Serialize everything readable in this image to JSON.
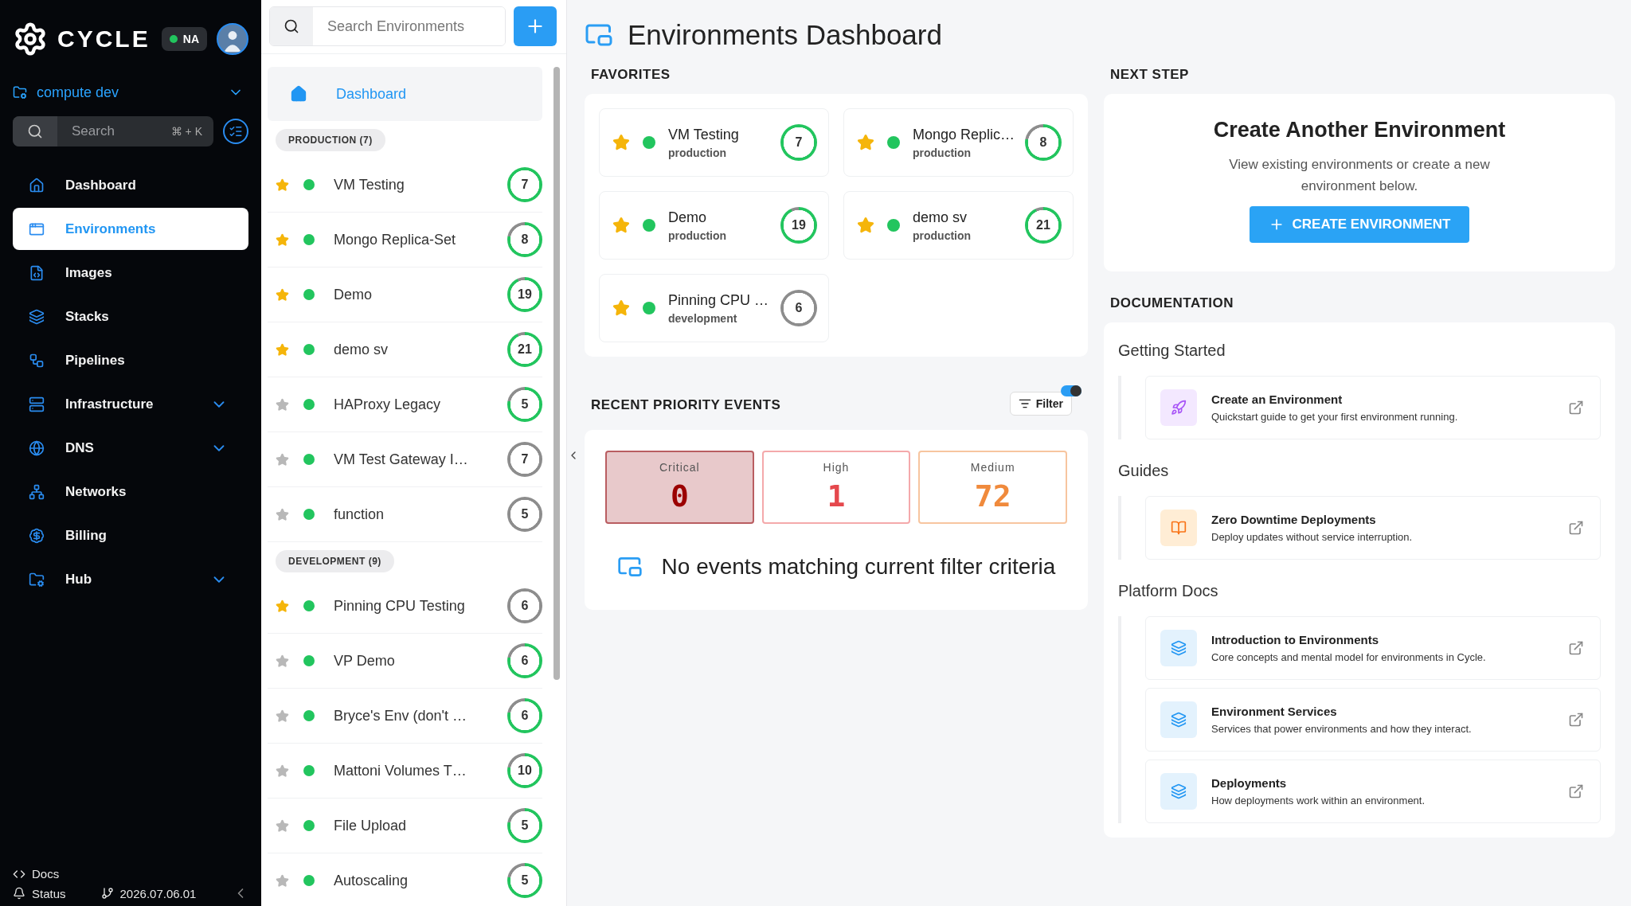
{
  "sidebar": {
    "brand": "CYCLE",
    "region": {
      "label": "NA",
      "online": true
    },
    "hub": "compute dev",
    "search": {
      "placeholder": "Search",
      "shortcut": "⌘ + K"
    },
    "nav": [
      {
        "label": "Dashboard",
        "selected": false,
        "expandable": false
      },
      {
        "label": "Environments",
        "selected": true,
        "expandable": false
      },
      {
        "label": "Images",
        "selected": false,
        "expandable": false
      },
      {
        "label": "Stacks",
        "selected": false,
        "expandable": false
      },
      {
        "label": "Pipelines",
        "selected": false,
        "expandable": false
      },
      {
        "label": "Infrastructure",
        "selected": false,
        "expandable": true
      },
      {
        "label": "DNS",
        "selected": false,
        "expandable": true
      },
      {
        "label": "Networks",
        "selected": false,
        "expandable": false
      },
      {
        "label": "Billing",
        "selected": false,
        "expandable": false
      },
      {
        "label": "Hub",
        "selected": false,
        "expandable": true
      }
    ],
    "footer": {
      "docs": "Docs",
      "status": "Status",
      "version": "2026.07.06.01"
    }
  },
  "environments_list": {
    "search": {
      "placeholder": "Search Environments"
    },
    "dashboard_link": "Dashboard",
    "groups": [
      {
        "label": "PRODUCTION (7)",
        "items": [
          {
            "name": "VM Testing",
            "favorite": true,
            "count": "7",
            "kind": "full"
          },
          {
            "name": "Mongo Replica-Set",
            "favorite": true,
            "count": "8",
            "kind": "partial"
          },
          {
            "name": "Demo",
            "favorite": true,
            "count": "19",
            "kind": "mostly"
          },
          {
            "name": "demo sv",
            "favorite": true,
            "count": "21",
            "kind": "mostly"
          },
          {
            "name": "HAProxy Legacy",
            "favorite": false,
            "count": "5",
            "kind": "partial"
          },
          {
            "name": "VM Test Gateway I…",
            "favorite": false,
            "count": "7",
            "kind": "idle"
          },
          {
            "name": "function",
            "favorite": false,
            "count": "5",
            "kind": "idle"
          }
        ]
      },
      {
        "label": "DEVELOPMENT (9)",
        "items": [
          {
            "name": "Pinning CPU Testing",
            "favorite": true,
            "count": "6",
            "kind": "idle"
          },
          {
            "name": "VP Demo",
            "favorite": false,
            "count": "6",
            "kind": "partial"
          },
          {
            "name": "Bryce's Env (don't …",
            "favorite": false,
            "count": "6",
            "kind": "partial"
          },
          {
            "name": "Mattoni Volumes T…",
            "favorite": false,
            "count": "10",
            "kind": "partial"
          },
          {
            "name": "File Upload",
            "favorite": false,
            "count": "5",
            "kind": "partial"
          },
          {
            "name": "Autoscaling",
            "favorite": false,
            "count": "5",
            "kind": "partial"
          }
        ]
      }
    ]
  },
  "main": {
    "title": "Environments Dashboard",
    "favorites": {
      "heading": "FAVORITES",
      "items": [
        {
          "name": "VM Testing",
          "environment": "production",
          "favorite": true,
          "count": "7",
          "kind": "full"
        },
        {
          "name": "Mongo Replic…",
          "environment": "production",
          "favorite": true,
          "count": "8",
          "kind": "partial"
        },
        {
          "name": "Demo",
          "environment": "production",
          "favorite": true,
          "count": "19",
          "kind": "mostly"
        },
        {
          "name": "demo sv",
          "environment": "production",
          "favorite": true,
          "count": "21",
          "kind": "mostly"
        },
        {
          "name": "Pinning CPU …",
          "environment": "development",
          "favorite": true,
          "count": "6",
          "kind": "idle"
        }
      ]
    },
    "events": {
      "heading": "RECENT PRIORITY EVENTS",
      "filter": {
        "label": "Filter",
        "on": true
      },
      "severities": [
        {
          "kind": "critical",
          "label": "Critical",
          "count": "0",
          "selected": true
        },
        {
          "kind": "high",
          "label": "High",
          "count": "1",
          "selected": false
        },
        {
          "kind": "medium",
          "label": "Medium",
          "count": "72",
          "selected": false
        }
      ],
      "empty_message": "No events matching current filter criteria"
    },
    "next_step": {
      "heading": "NEXT STEP",
      "title": "Create Another Environment",
      "description": "View existing environments or create a new environment below.",
      "button": "CREATE ENVIRONMENT"
    },
    "documentation": {
      "heading": "DOCUMENTATION",
      "groups": [
        {
          "title": "Getting Started",
          "items": [
            {
              "kind": "quickstart",
              "title": "Create an Environment",
              "description": "Quickstart guide to get your first environment running."
            }
          ]
        },
        {
          "title": "Guides",
          "items": [
            {
              "kind": "guide",
              "title": "Zero Downtime Deployments",
              "description": "Deploy updates without service interruption."
            }
          ]
        },
        {
          "title": "Platform Docs",
          "items": [
            {
              "kind": "doc",
              "title": "Introduction to Environments",
              "description": "Core concepts and mental model for environments in Cycle."
            },
            {
              "kind": "doc",
              "title": "Environment Services",
              "description": "Services that power environments and how they interact."
            },
            {
              "kind": "doc",
              "title": "Deployments",
              "description": "How deployments work within an environment."
            }
          ]
        }
      ]
    }
  }
}
